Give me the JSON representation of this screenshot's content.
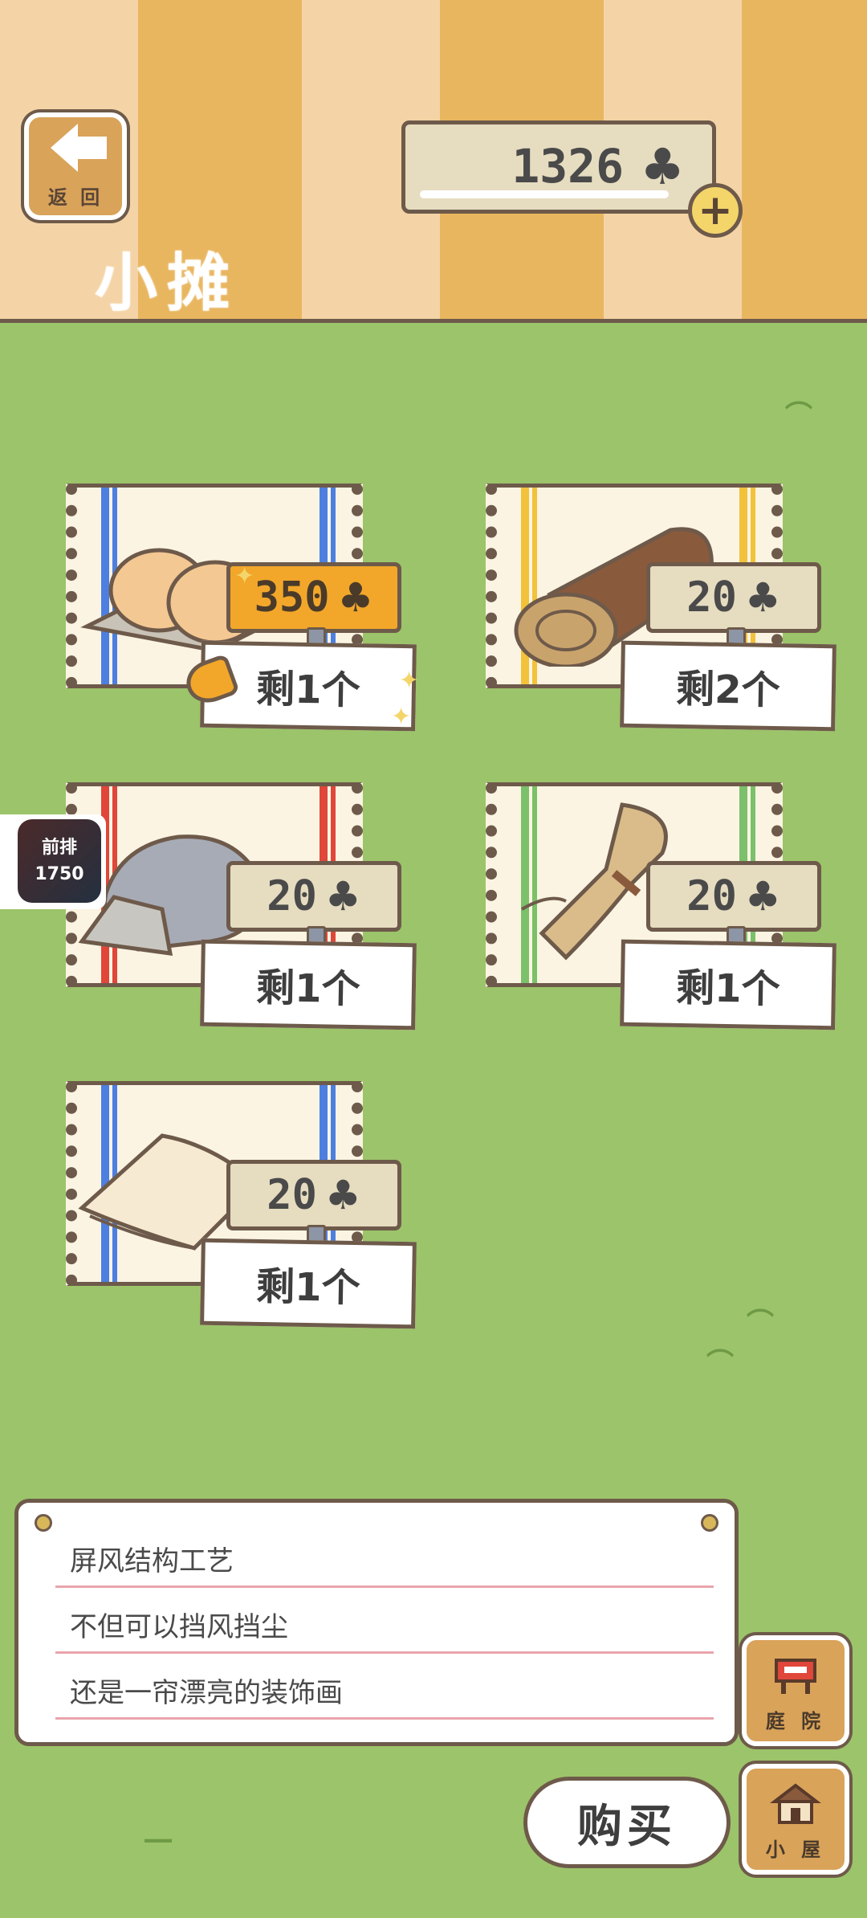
{
  "header": {
    "back_label": "返 回",
    "title": "小摊",
    "currency_amount": "1326",
    "currency_icon": "clover-icon",
    "plus_label": "+"
  },
  "items": [
    {
      "name": "bread",
      "price": "350",
      "stock": "剩1个",
      "highlight": true,
      "band_color": "#4d7fe0"
    },
    {
      "name": "log",
      "price": "20",
      "stock": "剩2个",
      "highlight": false,
      "band_color": "#f2c23a"
    },
    {
      "name": "stone",
      "price": "20",
      "stock": "剩1个",
      "highlight": false,
      "band_color": "#e0463a"
    },
    {
      "name": "straw",
      "price": "20",
      "stock": "剩1个",
      "highlight": false,
      "band_color": "#7bc06a"
    },
    {
      "name": "cloth",
      "price": "20",
      "stock": "剩1个",
      "highlight": false,
      "band_color": "#4d7fe0"
    }
  ],
  "clover_glyph": "♣",
  "rank_badge": {
    "line1": "前排",
    "line2": "1750"
  },
  "description": {
    "line1": "屏风结构工艺",
    "line2": "不但可以挡风挡尘",
    "line3": "还是一帘漂亮的装饰画"
  },
  "buttons": {
    "buy": "购买",
    "yard": "庭 院",
    "house": "小 屋"
  },
  "colors": {
    "grass": "#9cc46a",
    "stripe_light": "#f4d4a6",
    "stripe_dark": "#e9b660",
    "outline": "#6e5a4a",
    "price_hot": "#f2a72a"
  }
}
